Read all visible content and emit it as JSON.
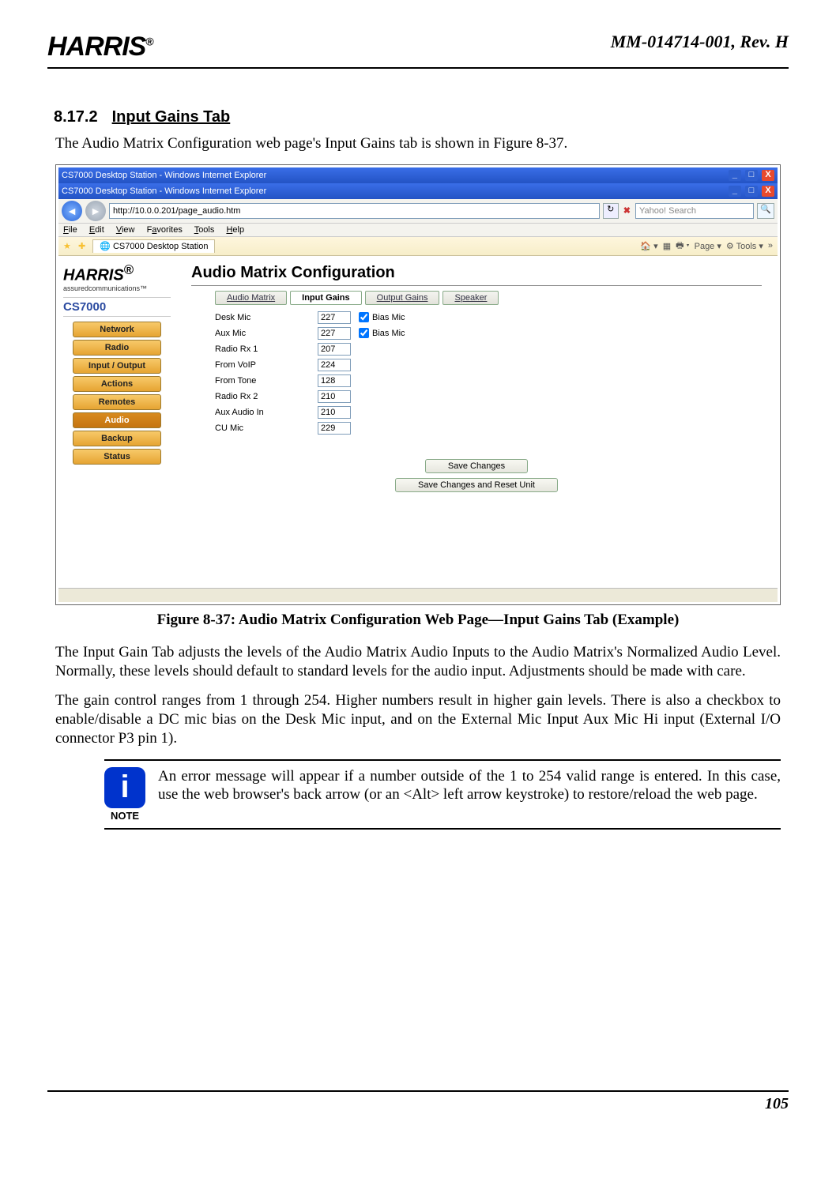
{
  "header": {
    "brand": "HARRIS",
    "reg": "®",
    "doc_id": "MM-014714-001, Rev. H"
  },
  "section": {
    "number": "8.17.2",
    "title": "Input Gains Tab"
  },
  "intro": "The Audio Matrix Configuration web page's Input Gains tab is shown in Figure 8-37.",
  "figure_caption": "Figure 8-37:  Audio Matrix Configuration Web Page—Input Gains Tab (Example)",
  "para1": "The Input Gain Tab adjusts the levels of the Audio Matrix Audio Inputs to the Audio Matrix's Normalized Audio Level.  Normally, these levels should default to standard levels for the audio input.  Adjustments should be made with care.",
  "para2": "The gain control ranges from 1 through 254.  Higher numbers result in higher gain levels.  There is also a checkbox to enable/disable a DC mic bias on the Desk Mic input, and on the External Mic Input Aux Mic Hi input (External I/O connector P3 pin 1).",
  "note": {
    "label": "NOTE",
    "icon_char": "i",
    "text": "An error message will appear if a number outside of the 1 to 254 valid range is entered.  In this case, use the web browser's back arrow (or an <Alt> left arrow keystroke) to restore/reload the web page."
  },
  "footer": {
    "page_num": "105"
  },
  "screenshot": {
    "outer_title": "CS7000 Desktop Station - Windows Internet Explorer",
    "inner_title": "CS7000 Desktop Station - Windows Internet Explorer",
    "url": "http://10.0.0.201/page_audio.htm",
    "search_placeholder": "Yahoo! Search",
    "menu": [
      "File",
      "Edit",
      "View",
      "Favorites",
      "Tools",
      "Help"
    ],
    "fav_tab": "CS7000 Desktop Station",
    "toolbar": {
      "page": "Page",
      "tools": "Tools"
    },
    "sidebar": {
      "brand": "HARRIS",
      "reg": "®",
      "tagline": "assuredcommunications™",
      "product": "CS7000",
      "items": [
        "Network",
        "Radio",
        "Input / Output",
        "Actions",
        "Remotes",
        "Audio",
        "Backup",
        "Status"
      ],
      "active_index": 5
    },
    "main": {
      "title": "Audio Matrix Configuration",
      "tabs": [
        "Audio Matrix",
        "Input Gains",
        "Output Gains",
        "Speaker"
      ],
      "active_tab_index": 1,
      "rows": [
        {
          "label": "Desk Mic",
          "value": "227",
          "bias": true,
          "bias_label": "Bias Mic"
        },
        {
          "label": "Aux Mic",
          "value": "227",
          "bias": true,
          "bias_label": "Bias Mic"
        },
        {
          "label": "Radio Rx 1",
          "value": "207"
        },
        {
          "label": "From VoIP",
          "value": "224"
        },
        {
          "label": "From Tone",
          "value": "128"
        },
        {
          "label": "Radio Rx 2",
          "value": "210"
        },
        {
          "label": "Aux Audio In",
          "value": "210"
        },
        {
          "label": "CU Mic",
          "value": "229"
        }
      ],
      "save1": "Save Changes",
      "save2": "Save Changes and Reset Unit"
    }
  }
}
